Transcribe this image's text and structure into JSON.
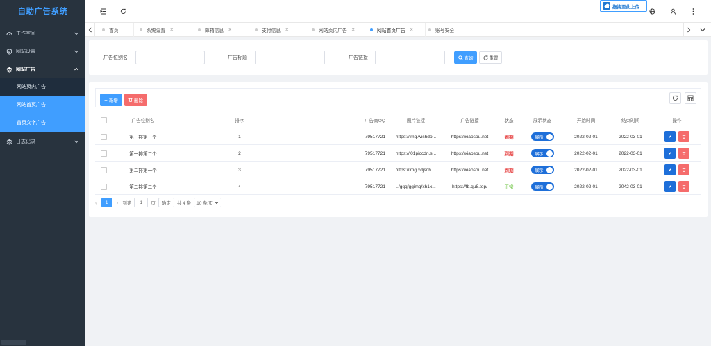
{
  "app": {
    "title": "自助广告系统"
  },
  "sidebar": {
    "items": [
      {
        "label": "工作空间",
        "icon": "dashboard-icon"
      },
      {
        "label": "网站设置",
        "icon": "shield-icon"
      },
      {
        "label": "网站广告",
        "icon": "layers-icon"
      },
      {
        "label": "日志记录",
        "icon": "layers-icon"
      }
    ],
    "sub_items": [
      {
        "label": "网站页内广告"
      },
      {
        "label": "网站首页广告"
      },
      {
        "label": "首页文字广告"
      }
    ]
  },
  "header": {
    "upload_label": "拖拽至此上传"
  },
  "tabs": [
    {
      "label": "首页"
    },
    {
      "label": "系统设置"
    },
    {
      "label": "邮箱信息"
    },
    {
      "label": "支付信息"
    },
    {
      "label": "网站页内广告"
    },
    {
      "label": "网站首页广告"
    },
    {
      "label": "账号安全"
    }
  ],
  "search": {
    "field1_label": "广告位别名",
    "field2_label": "广告标题",
    "field3_label": "广告链接",
    "search_btn": "查询",
    "reset_btn": "重置"
  },
  "toolbar": {
    "add_btn": "新增",
    "delete_btn": "删除"
  },
  "table": {
    "columns": [
      "广告位别名",
      "排序",
      "广告商QQ",
      "图片链接",
      "广告链接",
      "状态",
      "展示状态",
      "开始时间",
      "结束时间",
      "操作"
    ],
    "rows": [
      {
        "alias": "第一排第一个",
        "order": "1",
        "qq": "79517721",
        "img": "https://img.wishdo...",
        "link": "https://xiaosou.net",
        "status": "到期",
        "show": "展示",
        "start": "2022-02-01",
        "end": "2022-03-01"
      },
      {
        "alias": "第一排第二个",
        "order": "2",
        "qq": "79517721",
        "img": "https://i01piccdn.s...",
        "link": "https://xiaosou.net",
        "status": "到期",
        "show": "展示",
        "start": "2022-02-01",
        "end": "2022-03-01"
      },
      {
        "alias": "第二排第一个",
        "order": "3",
        "qq": "79517721",
        "img": "https://img.xdjsdh....",
        "link": "https://xiaosou.net",
        "status": "到期",
        "show": "展示",
        "start": "2022-02-01",
        "end": "2022-03-01"
      },
      {
        "alias": "第二排第二个",
        "order": "4",
        "qq": "79517721",
        "img": "../gqq/ggimg/xh1x...",
        "link": "https://fb.qu8.top/",
        "status": "正常",
        "show": "展示",
        "start": "2022-02-01",
        "end": "2042-03-01"
      }
    ]
  },
  "pagination": {
    "current": "1",
    "goto_label": "到第",
    "goto_value": "1",
    "page_unit": "页",
    "confirm": "确定",
    "total": "共 4 条",
    "page_size": "10 条/页"
  },
  "colors": {
    "primary": "#409eff",
    "danger": "#f56c6c",
    "sidebar": "#28333e",
    "expired": "#e64242",
    "normal": "#67c23a"
  }
}
